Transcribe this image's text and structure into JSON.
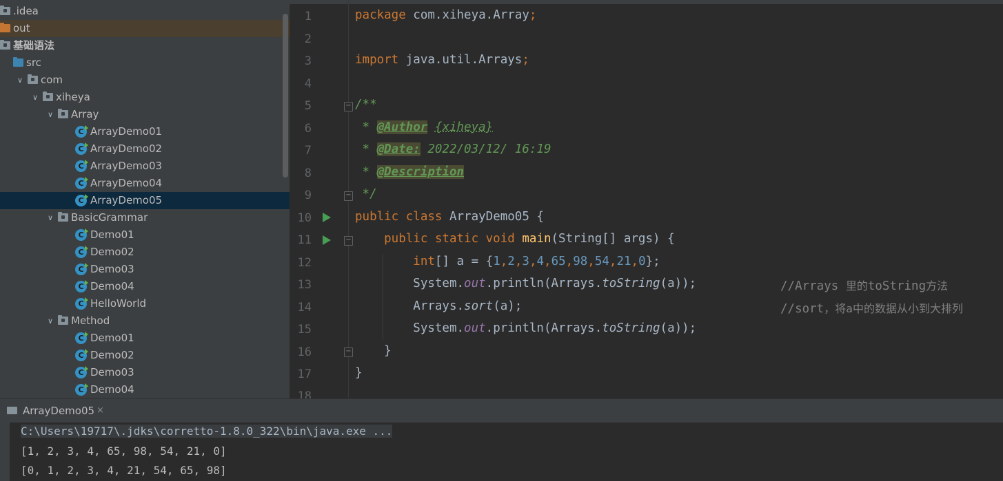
{
  "tree": {
    "items": [
      {
        "label": ".idea",
        "icon": "folder-grey-icon"
      },
      {
        "label": "out",
        "icon": "folder-orange-icon"
      },
      {
        "label": "基础语法",
        "icon": "module-folder-icon"
      },
      {
        "label": "src",
        "icon": "source-folder-icon"
      },
      {
        "label": "com",
        "icon": "package-icon"
      },
      {
        "label": "xiheya",
        "icon": "package-icon"
      },
      {
        "label": "Array",
        "icon": "package-icon"
      },
      {
        "label": "ArrayDemo01",
        "icon": "java-class-icon"
      },
      {
        "label": "ArrayDemo02",
        "icon": "java-class-icon"
      },
      {
        "label": "ArrayDemo03",
        "icon": "java-class-icon"
      },
      {
        "label": "ArrayDemo04",
        "icon": "java-class-icon"
      },
      {
        "label": "ArrayDemo05",
        "icon": "java-class-icon"
      },
      {
        "label": "BasicGrammar",
        "icon": "package-icon"
      },
      {
        "label": "Demo01",
        "icon": "java-class-icon"
      },
      {
        "label": "Demo02",
        "icon": "java-class-icon"
      },
      {
        "label": "Demo03",
        "icon": "java-class-icon"
      },
      {
        "label": "Demo04",
        "icon": "java-class-icon"
      },
      {
        "label": "HelloWorld",
        "icon": "java-class-icon"
      },
      {
        "label": "Method",
        "icon": "package-icon"
      },
      {
        "label": "Demo01",
        "icon": "java-class-icon"
      },
      {
        "label": "Demo02",
        "icon": "java-class-icon"
      },
      {
        "label": "Demo03",
        "icon": "java-class-icon"
      },
      {
        "label": "Demo04",
        "icon": "java-class-icon"
      }
    ],
    "selected": "ArrayDemo05",
    "class_icon_letter": "C"
  },
  "editor": {
    "line_numbers": [
      "1",
      "2",
      "3",
      "4",
      "5",
      "6",
      "7",
      "8",
      "9",
      "10",
      "11",
      "12",
      "13",
      "14",
      "15",
      "16",
      "17",
      "18"
    ],
    "code": {
      "l1_kw": "package",
      "l1_rest": " com.xiheya.Array",
      "l1_semi": ";",
      "l3_kw": "import",
      "l3_rest": " java.util.Arrays",
      "l3_semi": ";",
      "l5": "/**",
      "l6_star": " * ",
      "l6_tag": "@Author",
      "l6_sp": " ",
      "l6_val": "{xiheya}",
      "l7_star": " * ",
      "l7_tag": "@Date:",
      "l7_val": " 2022/03/12/ 16:19",
      "l8_star": " * ",
      "l8_tag": "@Description",
      "l9": " */",
      "l10_kw": "public class",
      "l10_rest": " ArrayDemo05 {",
      "l11_kw": "    public static void",
      "l11_sp": " ",
      "l11_fn": "main",
      "l11_rest": "(String[] args) {",
      "l12_kw": "        int",
      "l12_rest": "[] a = {",
      "l12_nums": [
        "1",
        "2",
        "3",
        "4",
        "65",
        "98",
        "54",
        "21",
        "0"
      ],
      "l12_end": "};",
      "l13_a": "        System.",
      "l13_out": "out",
      "l13_b": ".println(Arrays.",
      "l13_ts": "toString",
      "l13_c": "(a));",
      "l13_cmt_a": "//Arrays ",
      "l13_cmt_b": "里的",
      "l13_cmt_c": "toString",
      "l13_cmt_d": "方法",
      "l14_a": "        Arrays.",
      "l14_sort": "sort",
      "l14_b": "(a);",
      "l14_cmt_a": "//sort",
      "l14_cmt_b": "，将",
      "l14_cmt_c": "a",
      "l14_cmt_d": "中的数据从小到大排列",
      "l15_a": "        System.",
      "l15_out": "out",
      "l15_b": ".println(Arrays.",
      "l15_ts": "toString",
      "l15_c": "(a));",
      "l16": "    }",
      "l17": "}"
    }
  },
  "run_panel": {
    "tab_label": "ArrayDemo05",
    "tab_close": "×",
    "lines": [
      "C:\\Users\\19717\\.jdks\\corretto-1.8.0_322\\bin\\java.exe ...",
      "[1, 2, 3, 4, 65, 98, 54, 21, 0]",
      "[0, 1, 2, 3, 4, 21, 54, 65, 98]"
    ]
  },
  "colors": {
    "keyword": "#cc7832",
    "number": "#6897bb",
    "doc_comment": "#629755",
    "static_field": "#9876aa",
    "method_decl": "#ffc66d",
    "comment": "#808080",
    "selection": "#0d293e",
    "run_icon": "#499c54"
  }
}
